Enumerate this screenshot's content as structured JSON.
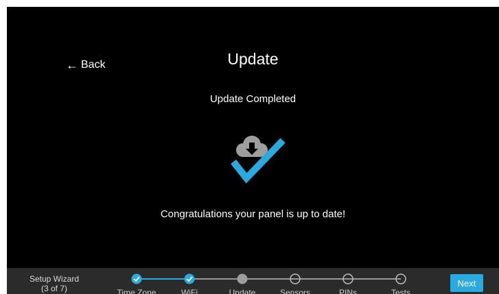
{
  "header": {
    "back_label": "Back",
    "title": "Update"
  },
  "main": {
    "status": "Update Completed",
    "message": "Congratulations your panel is up to date!",
    "icon": "cloud-download-check-icon"
  },
  "footer": {
    "wizard_title": "Setup Wizard",
    "wizard_progress": "(3 of 7)",
    "steps": [
      {
        "label": "Time Zone",
        "state": "complete"
      },
      {
        "label": "WiFi",
        "state": "complete"
      },
      {
        "label": "Update",
        "state": "current"
      },
      {
        "label": "Sensors",
        "state": "pending"
      },
      {
        "label": "PINs",
        "state": "pending"
      },
      {
        "label": "Tests",
        "state": "pending"
      }
    ],
    "next_label": "Next"
  },
  "colors": {
    "accent": "#29abe2",
    "background": "#000000",
    "footer": "#2b2b2b",
    "cloud": "#9e9e9e",
    "current_step": "#9e9e9e"
  }
}
